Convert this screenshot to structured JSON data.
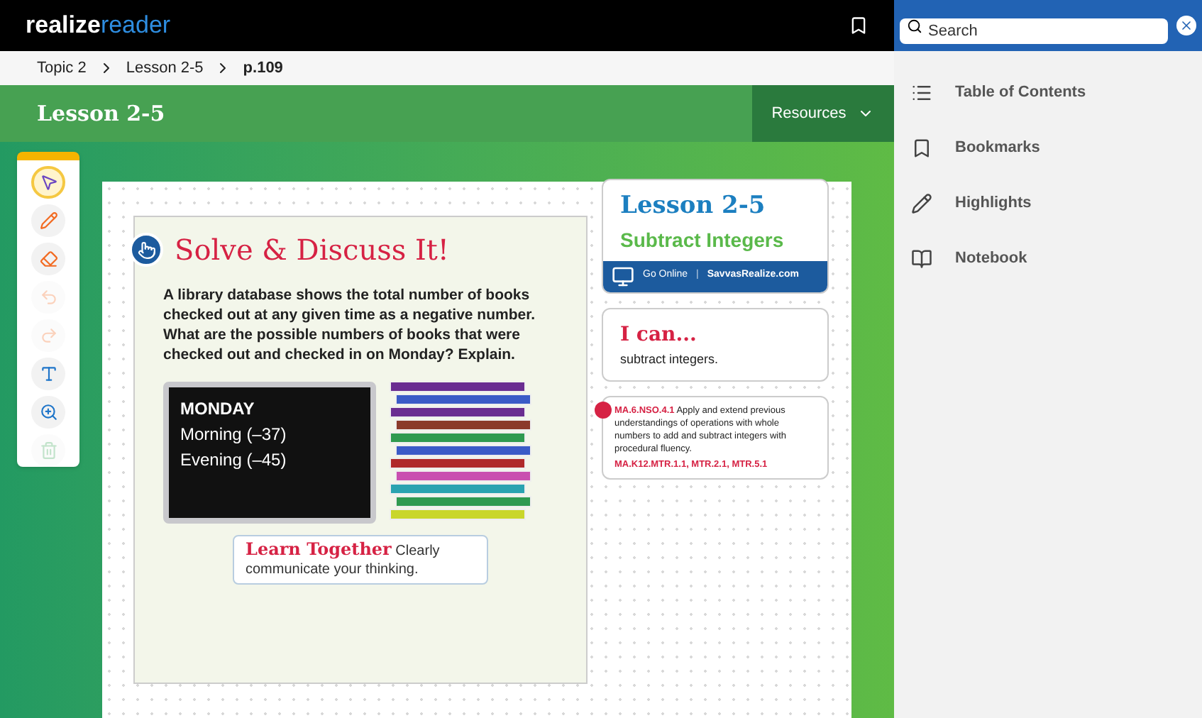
{
  "app": {
    "logo_a": "realize",
    "logo_b": "reader"
  },
  "breadcrumbs": [
    {
      "label": "Topic 2",
      "current": false
    },
    {
      "label": "Lesson 2-5",
      "current": false
    },
    {
      "label": "p.109",
      "current": true
    }
  ],
  "header": {
    "title": "Lesson 2-5",
    "resources": "Resources"
  },
  "tools": [
    {
      "kind": "select",
      "selected": true,
      "disabled": false
    },
    {
      "kind": "pen",
      "selected": false,
      "disabled": false
    },
    {
      "kind": "eraser",
      "selected": false,
      "disabled": false
    },
    {
      "kind": "undo",
      "selected": false,
      "disabled": true
    },
    {
      "kind": "redo",
      "selected": false,
      "disabled": true
    },
    {
      "kind": "text",
      "selected": false,
      "disabled": false
    },
    {
      "kind": "zoom",
      "selected": false,
      "disabled": false
    },
    {
      "kind": "trash",
      "selected": false,
      "disabled": true
    }
  ],
  "page": {
    "heading": "Solve & Discuss It!",
    "prompt": "A library database shows the total number of books checked out at any given time as a negative number. What are the possible numbers of books that were checked out and checked in on Monday? Explain.",
    "screen_lines": [
      "MONDAY",
      "Morning (–37)",
      "Evening (–45)"
    ],
    "learn_title": "Learn Together",
    "learn_text": "Clearly communicate your thinking.",
    "lesson_number": "Lesson 2-5",
    "lesson_title": "Subtract Integers",
    "go_online": "Go Online",
    "separator": "|",
    "site": "SavvasRealize.com",
    "ican_title": "I can...",
    "ican_text": "subtract integers.",
    "standard_code": "MA.6.NSO.4.1",
    "standard_text": "Apply and extend previous understandings of operations with whole numbers to add and subtract integers with procedural fluency.",
    "practices": "MA.K12.MTR.1.1, MTR.2.1, MTR.5.1"
  },
  "panel": {
    "search_placeholder": "Search",
    "items": [
      {
        "kind": "toc",
        "label": "Table of Contents"
      },
      {
        "kind": "bookmarks",
        "label": "Bookmarks"
      },
      {
        "kind": "highlights",
        "label": "Highlights"
      },
      {
        "kind": "notebook",
        "label": "Notebook"
      }
    ]
  }
}
